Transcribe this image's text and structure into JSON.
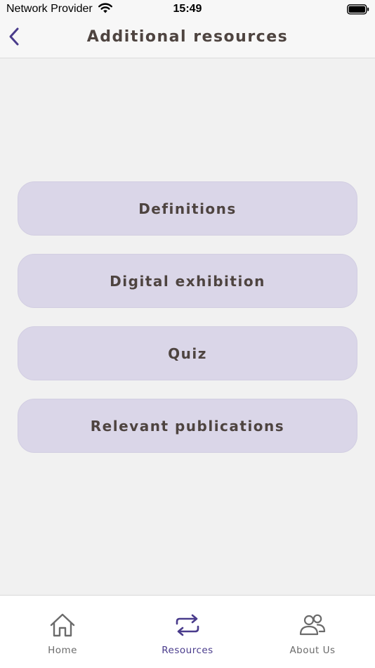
{
  "status_bar": {
    "carrier": "Network Provider",
    "time": "15:49"
  },
  "header": {
    "title": "Additional resources",
    "back_icon": "chevron-left-icon"
  },
  "menu": {
    "items": [
      {
        "label": "Definitions"
      },
      {
        "label": "Digital exhibition"
      },
      {
        "label": "Quiz"
      },
      {
        "label": "Relevant publications"
      }
    ]
  },
  "tab_bar": {
    "tabs": [
      {
        "label": "Home",
        "icon": "home-icon",
        "active": false
      },
      {
        "label": "Resources",
        "icon": "repeat-arrows-icon",
        "active": true
      },
      {
        "label": "About Us",
        "icon": "users-icon",
        "active": false
      }
    ]
  },
  "colors": {
    "accent": "#4a3c8c",
    "button_bg": "#dad6e8",
    "text": "#4e4440",
    "background": "#f1f1f1"
  }
}
